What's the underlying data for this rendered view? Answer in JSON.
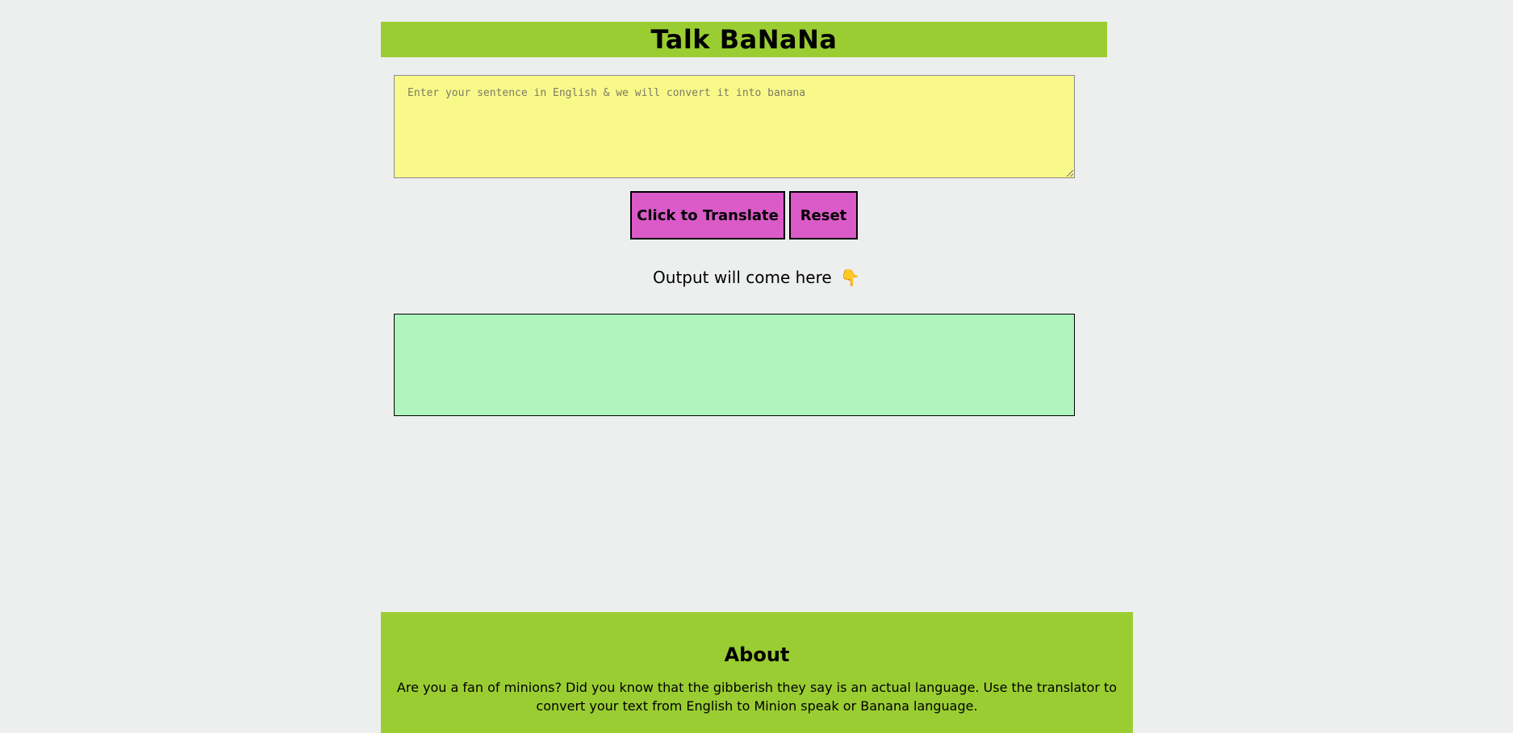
{
  "header": {
    "title": "Talk BaNaNa"
  },
  "translator": {
    "input_placeholder": "Enter your sentence in English & we will convert it into banana",
    "input_value": "",
    "translate_label": "Click to Translate",
    "reset_label": "Reset",
    "output_label": "Output will come here",
    "output_icon": "👇",
    "output_value": ""
  },
  "about": {
    "title": "About",
    "text": "Are you a fan of minions? Did you know that the gibberish they say is an actual language. Use the translator to convert your text from English to Minion speak or Banana language."
  },
  "colors": {
    "background": "#edefee",
    "header": "#9acd32",
    "input": "#f9f98a",
    "button": "#da5ac8",
    "output": "#b0f5bd"
  }
}
